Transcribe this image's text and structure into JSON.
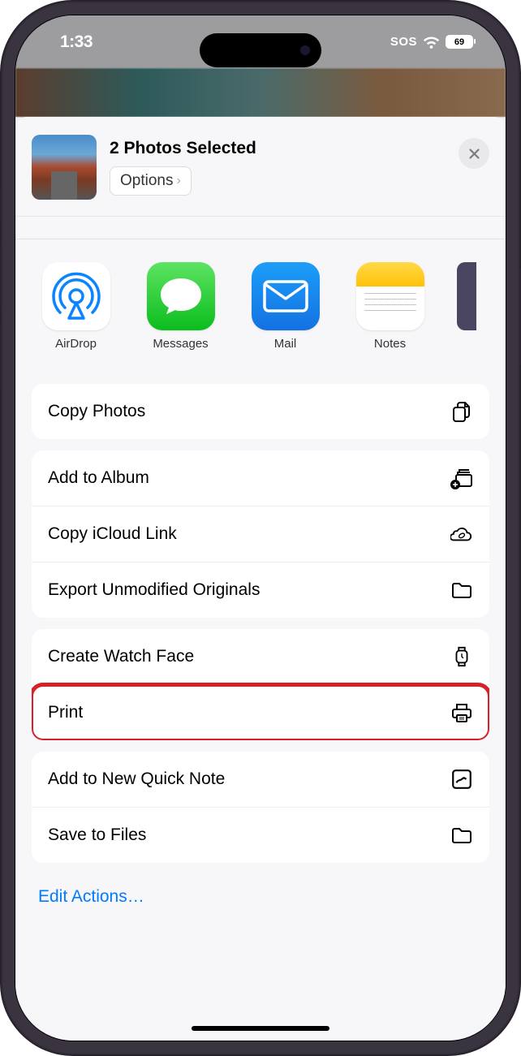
{
  "status": {
    "time": "1:33",
    "sos": "SOS",
    "battery_pct": "69"
  },
  "header": {
    "title": "2 Photos Selected",
    "options_label": "Options"
  },
  "apps": {
    "airdrop": "AirDrop",
    "messages": "Messages",
    "mail": "Mail",
    "notes": "Notes"
  },
  "actions": {
    "copy_photos": "Copy Photos",
    "add_to_album": "Add to Album",
    "copy_icloud": "Copy iCloud Link",
    "export_unmodified": "Export Unmodified Originals",
    "create_watch_face": "Create Watch Face",
    "print": "Print",
    "add_quick_note": "Add to New Quick Note",
    "save_to_files": "Save to Files"
  },
  "footer": {
    "edit_actions": "Edit Actions…"
  }
}
